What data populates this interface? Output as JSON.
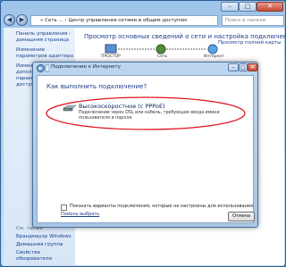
{
  "window": {
    "address": "« Сеть ... › Центр управления сетями и общим доступом",
    "search_placeholder": "Поиск в панели управления"
  },
  "sidebar": {
    "items": [
      "Панель управления - домашняя страница",
      "Изменение параметров адаптера",
      "Изменить дополнительные параметры общего доступа"
    ],
    "see_also": "См. также",
    "bottom_links": [
      "Брандмауэр Windows",
      "Домашняя группа",
      "Свойства обозревателя"
    ]
  },
  "main": {
    "title": "Просмотр основных сведений о сети и настройка подключений",
    "full_map_link": "Просмотр полной карты",
    "net_labels": [
      "ПРОСТОР",
      "Сеть",
      "Интернет"
    ]
  },
  "dialog": {
    "title": "Подключение к Интернету",
    "heading": "Как выполнить подключение?",
    "option_title": "Высокоскоростное (с PPPoE)",
    "option_desc": "Подключение через DSL или кабель, требующее ввода имени пользователя и пароля.",
    "checkbox_label": "Показать варианты подключения, которые не настроены для использования",
    "help_link": "Помочь выбрать",
    "cancel_label": "Отмена"
  },
  "colors": {
    "accent": "#1e3c8a",
    "highlight": "#e0101a"
  }
}
